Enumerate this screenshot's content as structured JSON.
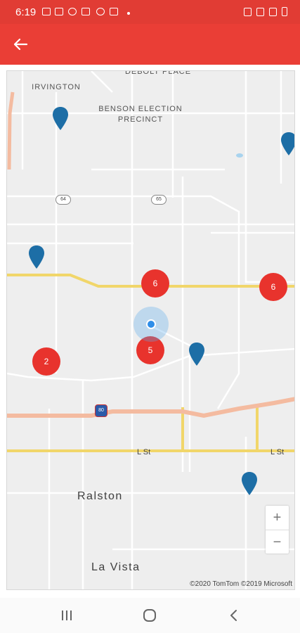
{
  "status_bar": {
    "time": "6:19"
  },
  "app_bar": {
    "back_icon": "arrow-left-icon",
    "color": "#ea3e36"
  },
  "map": {
    "labels": {
      "irvington": "IRVINGTON",
      "benson_line1": "BENSON ELECTION",
      "benson_line2": "PRECINCT",
      "debolt": "DEBOLT PLACE",
      "ralston": "Ralston",
      "la_vista": "La Vista",
      "l_st_1": "L St",
      "l_st_2": "L St"
    },
    "highway_shields": [
      "64",
      "65",
      "80"
    ],
    "clusters": [
      {
        "count": "6"
      },
      {
        "count": "6"
      },
      {
        "count": "5"
      },
      {
        "count": "2"
      }
    ],
    "pin_color": "#1d6ea6",
    "cluster_color": "#e8332d",
    "zoom_in": "+",
    "zoom_out": "−",
    "copyright": "©2020 TomTom ©2019 Microsoft"
  },
  "nav_bar": {
    "recents_icon": "recents-icon",
    "home_icon": "home-icon",
    "back_icon": "back-icon"
  }
}
